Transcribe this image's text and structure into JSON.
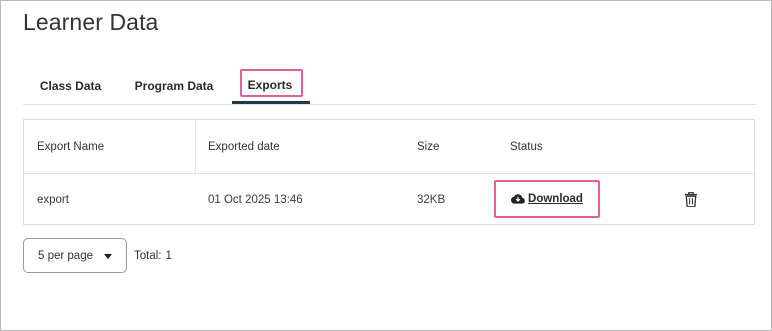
{
  "page": {
    "title": "Learner Data"
  },
  "tabs": [
    {
      "label": "Class Data",
      "active": false
    },
    {
      "label": "Program Data",
      "active": false
    },
    {
      "label": "Exports",
      "active": true
    }
  ],
  "table": {
    "columns": [
      "Export Name",
      "Exported date",
      "Size",
      "Status"
    ],
    "rows": [
      {
        "name": "export",
        "exported_date": "01 Oct 2025 13:46",
        "size": "32KB",
        "status_label": "Download",
        "status_icon": "cloud-download-icon",
        "action_icon": "trash-icon"
      }
    ]
  },
  "pagination": {
    "per_page": "5 per page",
    "total_label": "Total:",
    "total_value": "1"
  },
  "colors": {
    "highlight": "#e0609a",
    "active_tab_underline": "#1f3a4d"
  }
}
